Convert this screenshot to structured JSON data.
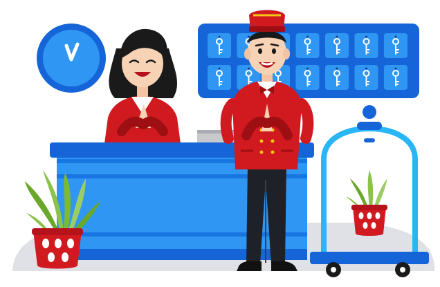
{
  "scene": {
    "description_free": true,
    "icons": {
      "clock": "clock-icon",
      "key": "key-icon",
      "plant": "potted-plant-icon",
      "luggage_cart": "luggage-cart-icon",
      "receptionist": "receptionist-icon",
      "bellboy": "bellboy-icon"
    },
    "key_board": {
      "rows": 2,
      "columns": 7
    },
    "colors": {
      "blue": "#1565d8",
      "light_blue": "#2f96f3",
      "red": "#d11a20",
      "dark_red": "#9e0f14",
      "floor_gray": "#dfe1e6",
      "plant_green": "#7dbb2e",
      "cart_outline": "#29b6f6"
    }
  }
}
